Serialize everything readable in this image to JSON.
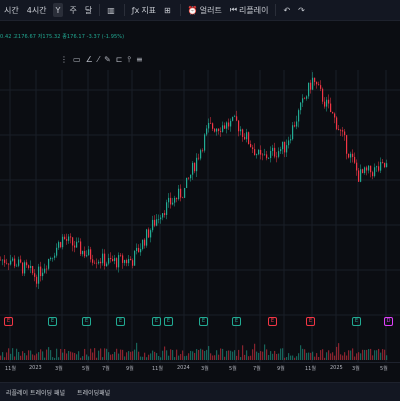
{
  "toolbar": {
    "items": [
      "시간",
      "4시간",
      "Y",
      "주",
      "달"
    ],
    "active_index": 2,
    "indicators_label": "지표",
    "alert_label": "얼러트",
    "replay_label": "리플레이",
    "undo_icon": "undo-icon",
    "redo_icon": "redo-icon"
  },
  "ohlc_text": "0.42 고176.67 저175.32 종176.17 -3.37 (-1.95%)",
  "xaxis": {
    "labels": [
      "11월",
      "2023",
      "3월",
      "5월",
      "7월",
      "9월",
      "11월",
      "2024",
      "3월",
      "5월",
      "7월",
      "9월",
      "11월",
      "2025",
      "3월",
      "5월"
    ]
  },
  "events": [
    {
      "glyph": "E",
      "color": "#f23645"
    },
    {
      "glyph": "E",
      "color": "#22ab94"
    },
    {
      "glyph": "E",
      "color": "#22ab94"
    },
    {
      "glyph": "E",
      "color": "#22ab94"
    },
    {
      "glyph": "E",
      "color": "#22ab94"
    },
    {
      "glyph": "E",
      "color": "#22ab94"
    },
    {
      "glyph": "E",
      "color": "#22ab94"
    },
    {
      "glyph": "E",
      "color": "#22ab94"
    },
    {
      "glyph": "E",
      "color": "#f23645"
    },
    {
      "glyph": "E",
      "color": "#f23645"
    },
    {
      "glyph": "E",
      "color": "#22ab94"
    },
    {
      "glyph": "D",
      "color": "#e040fb"
    }
  ],
  "bottom_tabs": [
    "리플레이 트레이딩 패널",
    "트레이딩패널"
  ],
  "colors": {
    "up": "#22ab94",
    "down": "#f23645",
    "grid": "#1a1e28"
  },
  "chart_data": {
    "type": "candlestick",
    "x": [
      "2022-11",
      "2023-01",
      "2023-03",
      "2023-05",
      "2023-07",
      "2023-09",
      "2023-11",
      "2024-01",
      "2024-03",
      "2024-05",
      "2024-07",
      "2024-09",
      "2024-11",
      "2025-01",
      "2025-03",
      "2025-05"
    ],
    "y": [
      0.23,
      0.16,
      0.32,
      0.25,
      0.22,
      0.23,
      0.43,
      0.52,
      0.78,
      0.8,
      0.65,
      0.7,
      0.98,
      0.8,
      0.58,
      0.62
    ],
    "volume": [
      0.3,
      0.35,
      0.4,
      0.45,
      0.5,
      0.45,
      0.55,
      0.6,
      0.5,
      0.55,
      0.5,
      0.5,
      0.6,
      0.55,
      0.45,
      0.4
    ]
  }
}
